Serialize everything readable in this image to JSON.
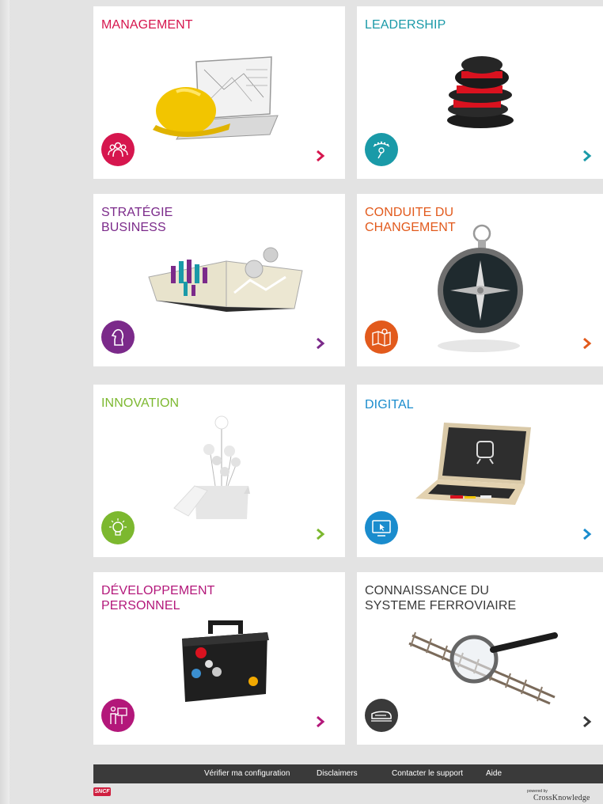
{
  "tiles": [
    {
      "title_lines": [
        "MANAGEMENT"
      ],
      "color": "#d6164e",
      "icon": "team-icon"
    },
    {
      "title_lines": [
        "LEADERSHIP"
      ],
      "color": "#1a9aa8",
      "icon": "leader-icon"
    },
    {
      "title_lines": [
        "STRATÉGIE",
        "BUSINESS"
      ],
      "color": "#7b2a8a",
      "icon": "chess-knight-icon"
    },
    {
      "title_lines": [
        "CONDUITE DU",
        "CHANGEMENT"
      ],
      "color": "#e25a1c",
      "icon": "map-icon"
    },
    {
      "title_lines": [
        "INNOVATION"
      ],
      "color": "#7cb82f",
      "icon": "lightbulb-icon"
    },
    {
      "title_lines": [
        "DIGITAL"
      ],
      "color": "#1a8ccd",
      "icon": "screen-icon"
    },
    {
      "title_lines": [
        "DÉVELOPPEMENT",
        "PERSONNEL"
      ],
      "color": "#b3177a",
      "icon": "presenter-icon"
    },
    {
      "title_lines": [
        "CONNAISSANCE DU",
        "SYSTEME FERROVIAIRE"
      ],
      "color": "#3a3a3a",
      "icon": "train-icon"
    }
  ],
  "footer": {
    "links": [
      "Vérifier ma configuration",
      "Disclaimers",
      "Contacter le support",
      "Aide"
    ]
  },
  "logos": {
    "sncf": "SNCF",
    "powered_by": "powered by",
    "crossknowledge": "CrossKnowledge"
  }
}
